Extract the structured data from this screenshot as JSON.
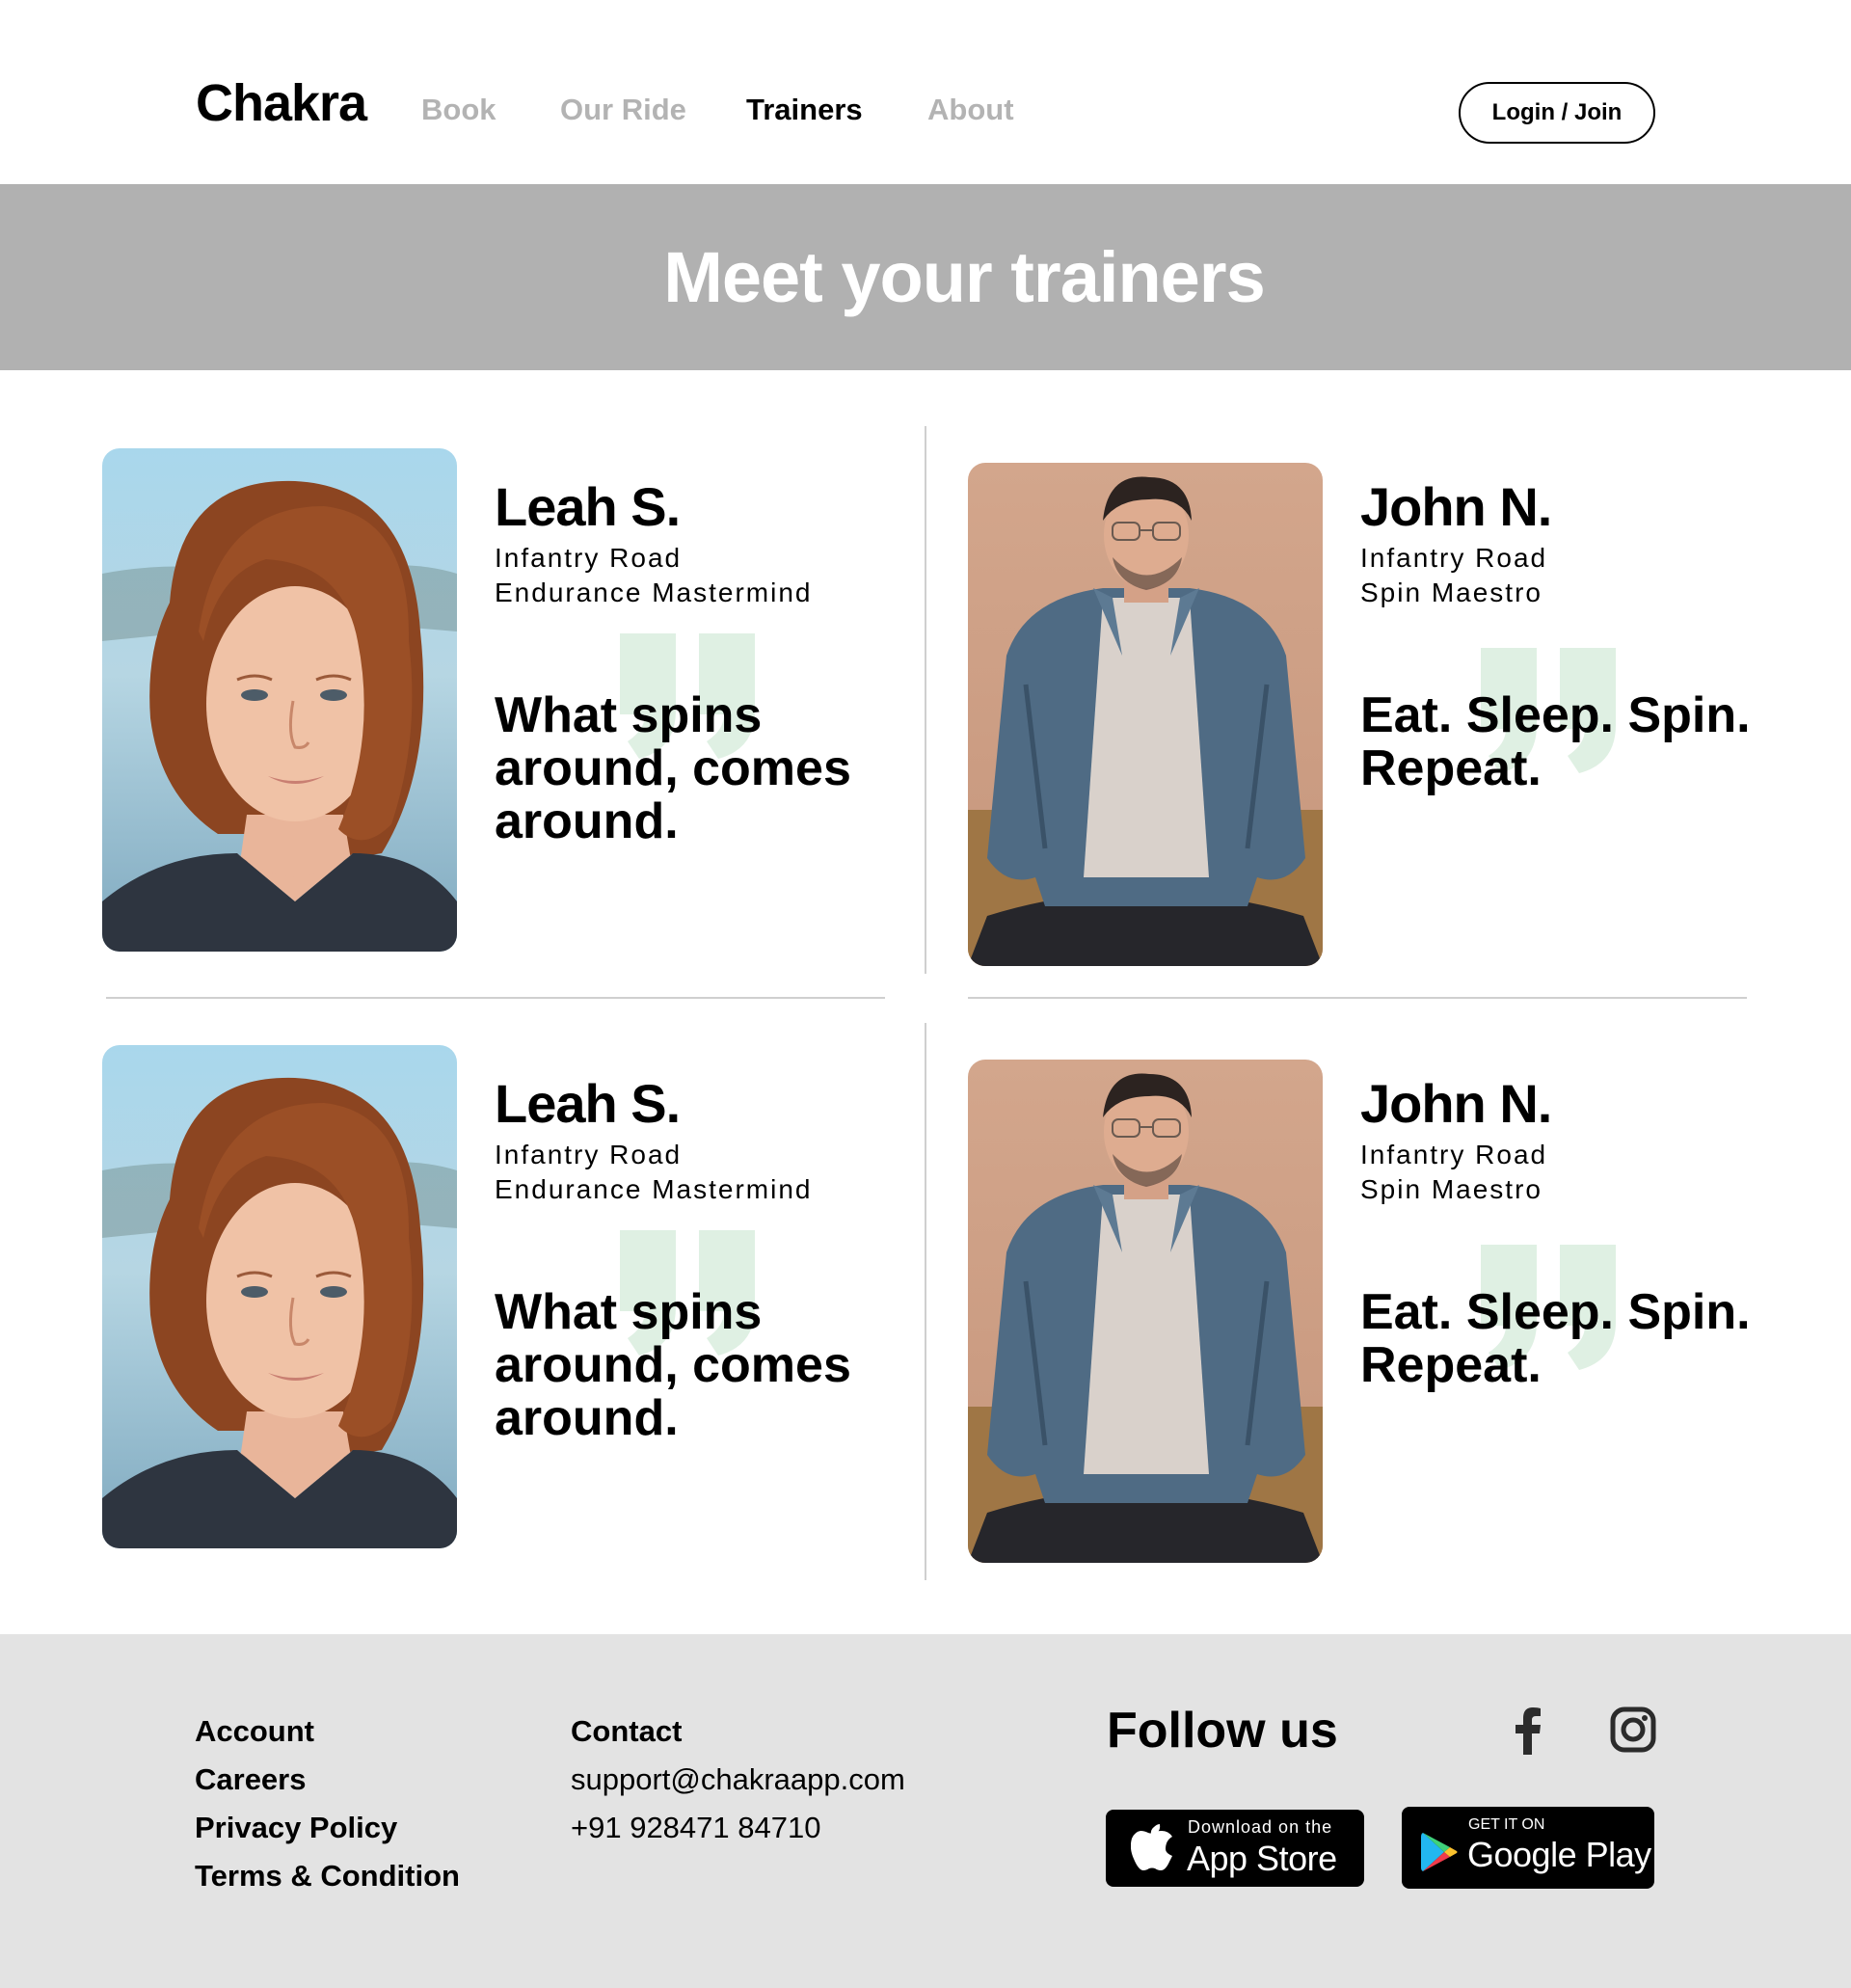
{
  "nav": {
    "logo": "Chakra",
    "links": [
      {
        "label": "Book"
      },
      {
        "label": "Our Ride"
      },
      {
        "label": "Trainers"
      },
      {
        "label": "About"
      }
    ],
    "login_label": "Login / Join"
  },
  "hero": {
    "title": "Meet your trainers"
  },
  "trainers": [
    {
      "name": "Leah S.",
      "location": "Infantry Road",
      "role": "Endurance Mastermind",
      "tagline": "What spins around, comes around."
    },
    {
      "name": "John N.",
      "location": "Infantry Road",
      "role": "Spin Maestro",
      "tagline": "Eat. Sleep. Spin. Repeat."
    },
    {
      "name": "Leah S.",
      "location": "Infantry Road",
      "role": "Endurance Mastermind",
      "tagline": "What spins around, comes around."
    },
    {
      "name": "John N.",
      "location": "Infantry Road",
      "role": "Spin Maestro",
      "tagline": "Eat. Sleep. Spin. Repeat."
    }
  ],
  "footer": {
    "links": [
      "Account",
      "Careers",
      "Privacy Policy",
      "Terms & Condition"
    ],
    "contact_heading": "Contact",
    "email": "support@chakraapp.com",
    "phone": "+91 928471 84710",
    "follow_heading": "Follow us",
    "social_icons": [
      "facebook-icon",
      "instagram-icon"
    ],
    "app_store": {
      "small": "Download on the",
      "big": "App Store"
    },
    "google_play": {
      "small": "GET IT ON",
      "big": "Google Play"
    }
  },
  "colors": {
    "hero_bg": "#b1b1b1",
    "footer_bg": "#e3e3e3",
    "quote_mark": "#dff0e3",
    "inactive_nav": "#b3b3b3"
  }
}
